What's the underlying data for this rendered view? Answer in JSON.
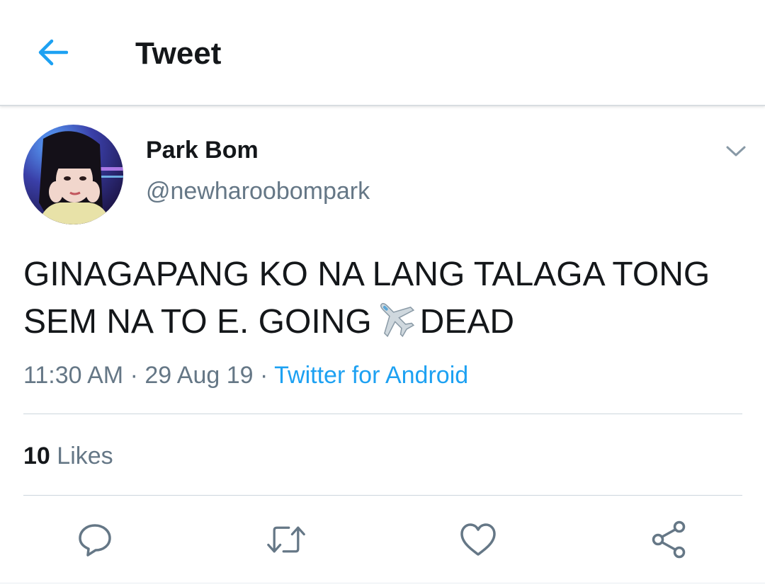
{
  "header": {
    "title": "Tweet",
    "back_icon": "arrow-left-icon"
  },
  "tweet": {
    "author": {
      "display_name": "Park Bom",
      "handle": "@newharoobompark"
    },
    "text_lines": [
      "GINAGAPANG KO NA LANG TALAGA TONG",
      "SEM NA TO E. GOING",
      "DEAD"
    ],
    "emoji": "airplane",
    "time": "11:30 AM",
    "date": "29 Aug 19",
    "separator": "·",
    "source": "Twitter for Android",
    "likes_count": "10",
    "likes_label": "Likes"
  },
  "actions": [
    "reply-icon",
    "retweet-icon",
    "like-icon",
    "share-icon"
  ],
  "colors": {
    "accent": "#1da1f2",
    "text_primary": "#14171a",
    "text_secondary": "#657786",
    "divider": "#ccd6dd"
  }
}
